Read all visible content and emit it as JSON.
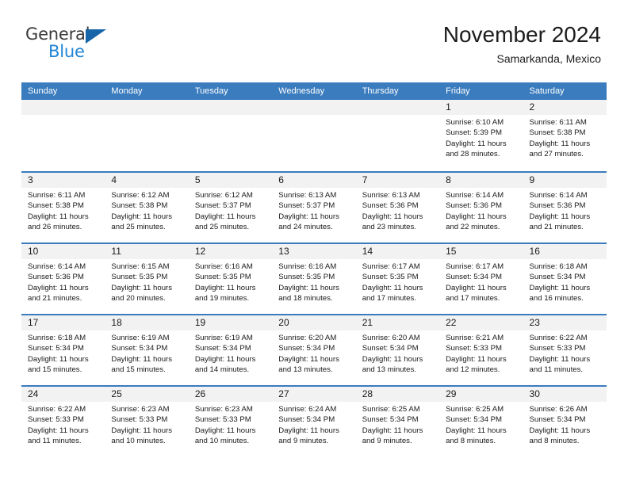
{
  "brand": {
    "name_part1": "General",
    "name_part2": "Blue",
    "triangle_color": "#1565a8",
    "blue_color": "#2186d6"
  },
  "header": {
    "title": "November 2024",
    "subtitle": "Samarkanda, Mexico",
    "accent_color": "#3a7cbe"
  },
  "weekdays": [
    {
      "label": "Sunday"
    },
    {
      "label": "Monday"
    },
    {
      "label": "Tuesday"
    },
    {
      "label": "Wednesday"
    },
    {
      "label": "Thursday"
    },
    {
      "label": "Friday"
    },
    {
      "label": "Saturday"
    }
  ],
  "weeks": [
    [
      {
        "day": "",
        "empty": true
      },
      {
        "day": "",
        "empty": true
      },
      {
        "day": "",
        "empty": true
      },
      {
        "day": "",
        "empty": true
      },
      {
        "day": "",
        "empty": true
      },
      {
        "day": "1",
        "sunrise": "Sunrise: 6:10 AM",
        "sunset": "Sunset: 5:39 PM",
        "daylight_line1": "Daylight: 11 hours",
        "daylight_line2": "and 28 minutes."
      },
      {
        "day": "2",
        "sunrise": "Sunrise: 6:11 AM",
        "sunset": "Sunset: 5:38 PM",
        "daylight_line1": "Daylight: 11 hours",
        "daylight_line2": "and 27 minutes."
      }
    ],
    [
      {
        "day": "3",
        "sunrise": "Sunrise: 6:11 AM",
        "sunset": "Sunset: 5:38 PM",
        "daylight_line1": "Daylight: 11 hours",
        "daylight_line2": "and 26 minutes."
      },
      {
        "day": "4",
        "sunrise": "Sunrise: 6:12 AM",
        "sunset": "Sunset: 5:38 PM",
        "daylight_line1": "Daylight: 11 hours",
        "daylight_line2": "and 25 minutes."
      },
      {
        "day": "5",
        "sunrise": "Sunrise: 6:12 AM",
        "sunset": "Sunset: 5:37 PM",
        "daylight_line1": "Daylight: 11 hours",
        "daylight_line2": "and 25 minutes."
      },
      {
        "day": "6",
        "sunrise": "Sunrise: 6:13 AM",
        "sunset": "Sunset: 5:37 PM",
        "daylight_line1": "Daylight: 11 hours",
        "daylight_line2": "and 24 minutes."
      },
      {
        "day": "7",
        "sunrise": "Sunrise: 6:13 AM",
        "sunset": "Sunset: 5:36 PM",
        "daylight_line1": "Daylight: 11 hours",
        "daylight_line2": "and 23 minutes."
      },
      {
        "day": "8",
        "sunrise": "Sunrise: 6:14 AM",
        "sunset": "Sunset: 5:36 PM",
        "daylight_line1": "Daylight: 11 hours",
        "daylight_line2": "and 22 minutes."
      },
      {
        "day": "9",
        "sunrise": "Sunrise: 6:14 AM",
        "sunset": "Sunset: 5:36 PM",
        "daylight_line1": "Daylight: 11 hours",
        "daylight_line2": "and 21 minutes."
      }
    ],
    [
      {
        "day": "10",
        "sunrise": "Sunrise: 6:14 AM",
        "sunset": "Sunset: 5:36 PM",
        "daylight_line1": "Daylight: 11 hours",
        "daylight_line2": "and 21 minutes."
      },
      {
        "day": "11",
        "sunrise": "Sunrise: 6:15 AM",
        "sunset": "Sunset: 5:35 PM",
        "daylight_line1": "Daylight: 11 hours",
        "daylight_line2": "and 20 minutes."
      },
      {
        "day": "12",
        "sunrise": "Sunrise: 6:16 AM",
        "sunset": "Sunset: 5:35 PM",
        "daylight_line1": "Daylight: 11 hours",
        "daylight_line2": "and 19 minutes."
      },
      {
        "day": "13",
        "sunrise": "Sunrise: 6:16 AM",
        "sunset": "Sunset: 5:35 PM",
        "daylight_line1": "Daylight: 11 hours",
        "daylight_line2": "and 18 minutes."
      },
      {
        "day": "14",
        "sunrise": "Sunrise: 6:17 AM",
        "sunset": "Sunset: 5:35 PM",
        "daylight_line1": "Daylight: 11 hours",
        "daylight_line2": "and 17 minutes."
      },
      {
        "day": "15",
        "sunrise": "Sunrise: 6:17 AM",
        "sunset": "Sunset: 5:34 PM",
        "daylight_line1": "Daylight: 11 hours",
        "daylight_line2": "and 17 minutes."
      },
      {
        "day": "16",
        "sunrise": "Sunrise: 6:18 AM",
        "sunset": "Sunset: 5:34 PM",
        "daylight_line1": "Daylight: 11 hours",
        "daylight_line2": "and 16 minutes."
      }
    ],
    [
      {
        "day": "17",
        "sunrise": "Sunrise: 6:18 AM",
        "sunset": "Sunset: 5:34 PM",
        "daylight_line1": "Daylight: 11 hours",
        "daylight_line2": "and 15 minutes."
      },
      {
        "day": "18",
        "sunrise": "Sunrise: 6:19 AM",
        "sunset": "Sunset: 5:34 PM",
        "daylight_line1": "Daylight: 11 hours",
        "daylight_line2": "and 15 minutes."
      },
      {
        "day": "19",
        "sunrise": "Sunrise: 6:19 AM",
        "sunset": "Sunset: 5:34 PM",
        "daylight_line1": "Daylight: 11 hours",
        "daylight_line2": "and 14 minutes."
      },
      {
        "day": "20",
        "sunrise": "Sunrise: 6:20 AM",
        "sunset": "Sunset: 5:34 PM",
        "daylight_line1": "Daylight: 11 hours",
        "daylight_line2": "and 13 minutes."
      },
      {
        "day": "21",
        "sunrise": "Sunrise: 6:20 AM",
        "sunset": "Sunset: 5:34 PM",
        "daylight_line1": "Daylight: 11 hours",
        "daylight_line2": "and 13 minutes."
      },
      {
        "day": "22",
        "sunrise": "Sunrise: 6:21 AM",
        "sunset": "Sunset: 5:33 PM",
        "daylight_line1": "Daylight: 11 hours",
        "daylight_line2": "and 12 minutes."
      },
      {
        "day": "23",
        "sunrise": "Sunrise: 6:22 AM",
        "sunset": "Sunset: 5:33 PM",
        "daylight_line1": "Daylight: 11 hours",
        "daylight_line2": "and 11 minutes."
      }
    ],
    [
      {
        "day": "24",
        "sunrise": "Sunrise: 6:22 AM",
        "sunset": "Sunset: 5:33 PM",
        "daylight_line1": "Daylight: 11 hours",
        "daylight_line2": "and 11 minutes."
      },
      {
        "day": "25",
        "sunrise": "Sunrise: 6:23 AM",
        "sunset": "Sunset: 5:33 PM",
        "daylight_line1": "Daylight: 11 hours",
        "daylight_line2": "and 10 minutes."
      },
      {
        "day": "26",
        "sunrise": "Sunrise: 6:23 AM",
        "sunset": "Sunset: 5:33 PM",
        "daylight_line1": "Daylight: 11 hours",
        "daylight_line2": "and 10 minutes."
      },
      {
        "day": "27",
        "sunrise": "Sunrise: 6:24 AM",
        "sunset": "Sunset: 5:34 PM",
        "daylight_line1": "Daylight: 11 hours",
        "daylight_line2": "and 9 minutes."
      },
      {
        "day": "28",
        "sunrise": "Sunrise: 6:25 AM",
        "sunset": "Sunset: 5:34 PM",
        "daylight_line1": "Daylight: 11 hours",
        "daylight_line2": "and 9 minutes."
      },
      {
        "day": "29",
        "sunrise": "Sunrise: 6:25 AM",
        "sunset": "Sunset: 5:34 PM",
        "daylight_line1": "Daylight: 11 hours",
        "daylight_line2": "and 8 minutes."
      },
      {
        "day": "30",
        "sunrise": "Sunrise: 6:26 AM",
        "sunset": "Sunset: 5:34 PM",
        "daylight_line1": "Daylight: 11 hours",
        "daylight_line2": "and 8 minutes."
      }
    ]
  ]
}
